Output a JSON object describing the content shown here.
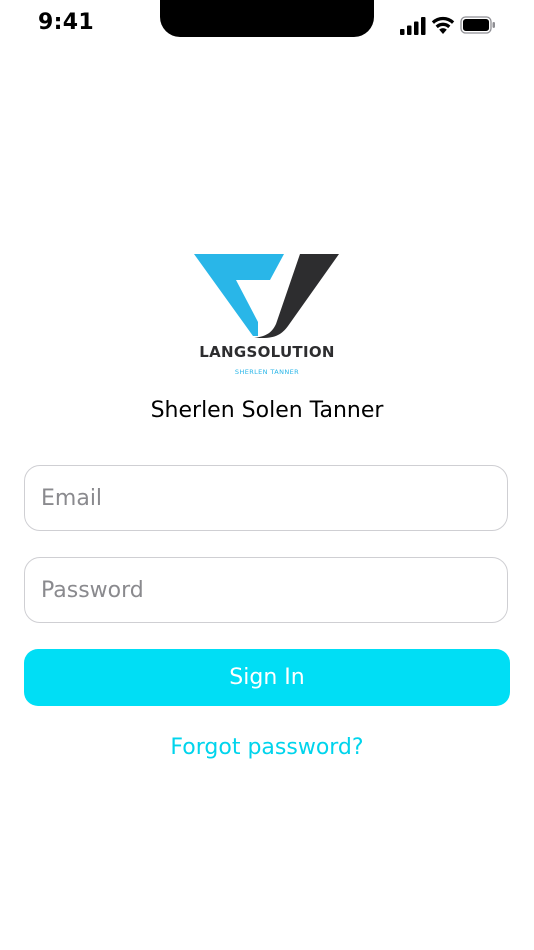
{
  "status_bar": {
    "time": "9:41",
    "icons": [
      "cellular-signal-icon",
      "wifi-icon",
      "battery-icon"
    ]
  },
  "brand": {
    "name": "LANGSOLUTION",
    "subtitle": "SHERLEN TANNER",
    "colors": {
      "primary_blue": "#29b6e8",
      "dark": "#2d2d2f"
    }
  },
  "user_name": "Sherlen Solen Tanner",
  "form": {
    "email": {
      "value": "",
      "placeholder": "Email"
    },
    "password": {
      "value": "",
      "placeholder": "Password"
    },
    "sign_in_label": "Sign In",
    "forgot_password_label": "Forgot password?"
  },
  "colors": {
    "accent": "#00def5",
    "link": "#00d4ec",
    "field_border": "#cfcfd3"
  }
}
